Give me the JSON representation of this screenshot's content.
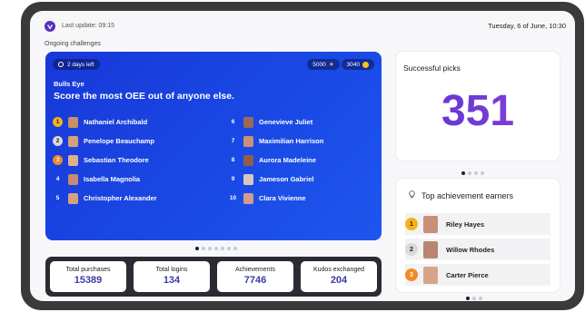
{
  "header": {
    "last_update": "Last update: 09:15",
    "date": "Tuesday, 6 of June, 10:30",
    "section_label": "Ongoing challenges"
  },
  "challenge": {
    "time_left": "2 days left",
    "stars": "5000",
    "coins": "3040",
    "title": "Bulls Eye",
    "description": "Score the most OEE out of anyone else.",
    "left": [
      {
        "rank": "1",
        "name": "Nathaniel Archibald"
      },
      {
        "rank": "2",
        "name": "Penelope Beauchamp"
      },
      {
        "rank": "3",
        "name": "Sebastian Theodore"
      },
      {
        "rank": "4",
        "name": "Isabella Magnolia"
      },
      {
        "rank": "5",
        "name": "Christopher Alexander"
      }
    ],
    "right": [
      {
        "rank": "6",
        "name": "Genevieve Juliet"
      },
      {
        "rank": "7",
        "name": "Maximilian Harrison"
      },
      {
        "rank": "8",
        "name": "Aurora Madeleine"
      },
      {
        "rank": "9",
        "name": "Jameson Gabriel"
      },
      {
        "rank": "10",
        "name": "Clara Vivienne"
      }
    ]
  },
  "stats": [
    {
      "label": "Total purchases",
      "value": "15389"
    },
    {
      "label": "Total logins",
      "value": "134"
    },
    {
      "label": "Achievements",
      "value": "7746"
    },
    {
      "label": "Kudos exchanged",
      "value": "204"
    }
  ],
  "picks": {
    "title": "Successful picks",
    "value": "351"
  },
  "achievers": {
    "title": "Top achievement earners",
    "items": [
      {
        "rank": "1",
        "name": "Riley Hayes"
      },
      {
        "rank": "2",
        "name": "Willow Rhodes"
      },
      {
        "rank": "3",
        "name": "Carter Pierce"
      }
    ]
  },
  "colors": {
    "accent": "#5a2fc2",
    "card_blue": "#1a44e2",
    "stat_value": "#3a3aa8"
  }
}
